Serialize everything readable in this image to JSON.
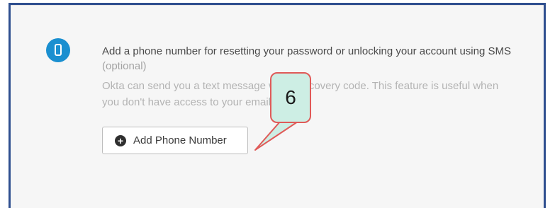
{
  "sms_section": {
    "heading": "Add a phone number for resetting your password or unlocking your account using SMS",
    "optional_label": "(optional)",
    "description": "Okta can send you a text message with a recovery code. This feature is useful when you don't have access to your email.",
    "add_button_label": "Add Phone Number",
    "phone_icon": "mobile-phone-icon",
    "plus_icon": "plus-circle-icon"
  },
  "callout": {
    "number": "6"
  },
  "colors": {
    "frame_border": "#2f4f8f",
    "badge_blue": "#1a8fd0",
    "callout_fill": "#cdeee4",
    "callout_border": "#e05a58"
  }
}
